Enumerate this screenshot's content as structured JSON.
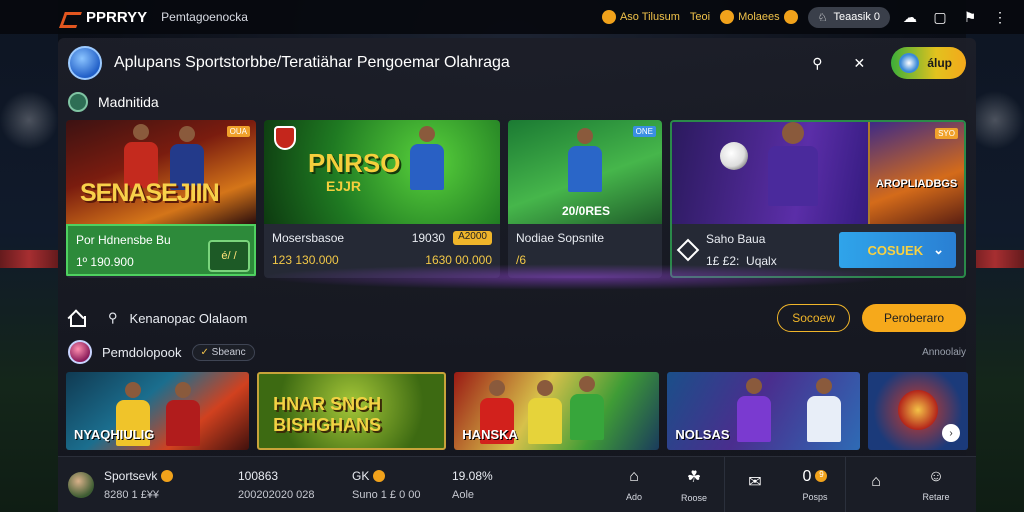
{
  "topbar": {
    "brand": "PPRRYY",
    "subtitle": "Pemtagoenocka",
    "links": [
      "Aso Tilusum",
      "Teoi",
      "Molaees"
    ],
    "user_label": "Teaasik 0",
    "accent": "#e2561f"
  },
  "header": {
    "title": "Aplupans Sportstorbbe/Teratiähar Pengoemar Olahraga",
    "cta_label": "álup"
  },
  "section1": {
    "title": "Madnitida"
  },
  "hero": [
    {
      "art_text": "SENASEJIIN",
      "badge": "OUA",
      "title": "Por Hdnensbe Bu",
      "line2": "1º 190.900",
      "box": "é/ /"
    },
    {
      "art_text": "PNRSO",
      "art_text2": "EJJR",
      "title": "Mosersbasoe",
      "value_r": "19030",
      "pill": "A2000",
      "line2": "123 130.000",
      "line2_r": "1630 00.000"
    },
    {
      "art_text": "20/0RES",
      "badge": "ONE",
      "title": "Nodiae Sopsnite",
      "line2": "/6"
    },
    {
      "poster_text": "AROPLIADBGS",
      "badge": "SYO",
      "title": "Saho Baua",
      "line2": "1£ £2:  Uqalx",
      "button": "COSUEK"
    }
  ],
  "section2": {
    "title": "Kenanopac Olalaom",
    "outline_btn": "Socoew",
    "orange_btn": "Peroberaro"
  },
  "section3": {
    "title": "Pemdolopook",
    "chip": "Sbeanc",
    "right_note": "Annoolaiy"
  },
  "thumbs": [
    {
      "label": "NYAQHIULIG"
    },
    {
      "label": "HNAR SNCH BISHGHANS"
    },
    {
      "label": "HANSKA"
    },
    {
      "label": "NOLSAS"
    },
    {
      "label": ""
    }
  ],
  "bottombar": {
    "user": "Sportsevk",
    "user_sub": "8280 1 £¥¥",
    "stat1": "100863",
    "stat1_sub": "200202020 028",
    "stat2": "GK",
    "stat2_sub": "Suno 1 £ 0 00",
    "stat3": "19.08%",
    "stat3_sub": "Aole",
    "nav": [
      "Ado",
      "Roose",
      "",
      "Posps",
      "",
      "Retare"
    ],
    "nav_glyphs": [
      "⌂",
      "☘",
      "✉",
      "0",
      "⌂",
      "☺"
    ],
    "nav_badge": "9"
  }
}
